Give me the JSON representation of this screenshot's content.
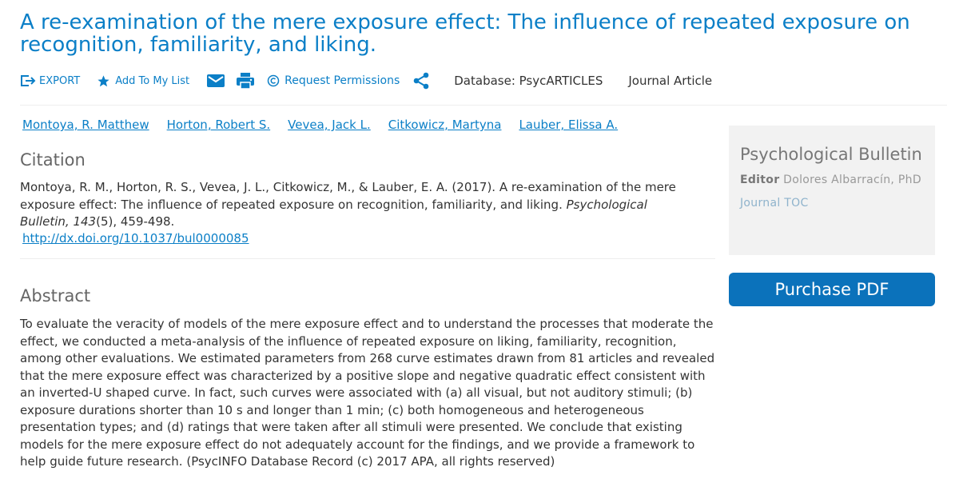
{
  "article": {
    "title": "A re-examination of the mere exposure effect: The influence of repeated exposure on recognition, familiarity, and liking."
  },
  "toolbar": {
    "export_label": "EXPORT",
    "add_label": "Add To My List",
    "permissions_label": "Request Permissions",
    "database": "Database: PsycARTICLES",
    "type": "Journal Article"
  },
  "authors": [
    "Montoya, R. Matthew",
    "Horton, Robert S.",
    "Vevea, Jack L.",
    "Citkowicz, Martyna",
    "Lauber, Elissa A."
  ],
  "citation": {
    "heading": "Citation",
    "prefix": "Montoya, R. M., Horton, R. S., Vevea, J. L., Citkowicz, M., & Lauber, E. A. (2017). A re-examination of the mere exposure effect: The influence of repeated exposure on recognition, familiarity, and liking. ",
    "journal": "Psychological Bulletin, 143",
    "suffix": "(5), 459-498.",
    "doi": "http://dx.doi.org/10.1037/bul0000085"
  },
  "abstract": {
    "heading": "Abstract",
    "text": "To evaluate the veracity of models of the mere exposure effect and to understand the processes that moderate the effect, we conducted a meta-analysis of the influence of repeated exposure on liking, familiarity, recognition, among other evaluations. We estimated parameters from 268 curve estimates drawn from 81 articles and revealed that the mere exposure effect was characterized by a positive slope and negative quadratic effect consistent with an inverted-U shaped curve. In fact, such curves were associated with (a) all visual, but not auditory stimuli; (b) exposure durations shorter than 10 s and longer than 1 min; (c) both homogeneous and heterogeneous presentation types; and (d) ratings that were taken after all stimuli were presented. We conclude that existing models for the mere exposure effect do not adequately account for the findings, and we provide a framework to help guide future research. (PsycINFO Database Record (c) 2017 APA, all rights reserved)"
  },
  "sidebar": {
    "journal": "Psychological Bulletin",
    "editor_label": "Editor",
    "editor_name": "Dolores Albarracín, PhD",
    "toc_label": "Journal TOC",
    "purchase_label": "Purchase PDF"
  },
  "colors": {
    "link": "#0b7fc7",
    "button": "#0b72bb"
  }
}
